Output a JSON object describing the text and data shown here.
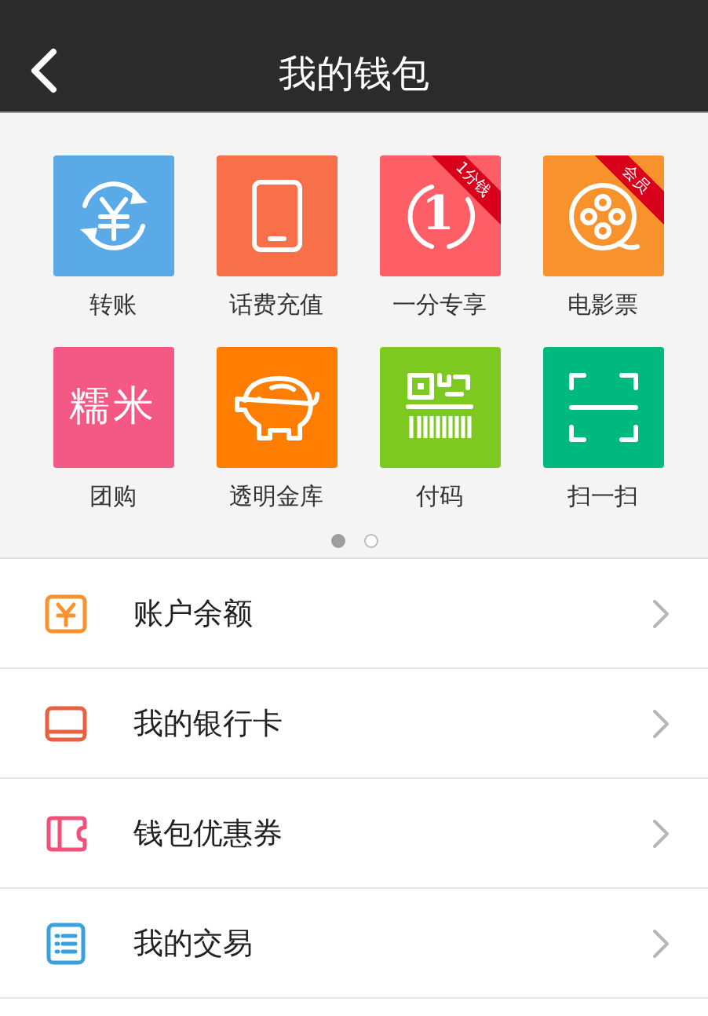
{
  "header": {
    "title": "我的钱包"
  },
  "grid": [
    {
      "label": "转账",
      "kind": "transfer",
      "color": "#5aaae7"
    },
    {
      "label": "话费充值",
      "kind": "phone",
      "color": "#f7704a"
    },
    {
      "label": "一分专享",
      "kind": "one",
      "color": "#fe5f67",
      "glyph": "1",
      "badge": "1分钱"
    },
    {
      "label": "电影票",
      "kind": "film",
      "color": "#f7922d",
      "badge": "会员"
    },
    {
      "label": "团购",
      "kind": "text",
      "color": "#f45985",
      "glyph": "糯米"
    },
    {
      "label": "透明金库",
      "kind": "piggy",
      "color": "#ff7d00"
    },
    {
      "label": "付码",
      "kind": "code",
      "color": "#7ec91f"
    },
    {
      "label": "扫一扫",
      "kind": "scan",
      "color": "#00b97f"
    }
  ],
  "pages": [
    {
      "selected": true
    },
    {
      "selected": false
    }
  ],
  "menu": [
    {
      "label": "账户余额",
      "kind": "balance",
      "color": "#f7922d"
    },
    {
      "label": "我的银行卡",
      "kind": "card",
      "color": "#e95f3f"
    },
    {
      "label": "钱包优惠券",
      "kind": "coupon",
      "color": "#f0507a"
    },
    {
      "label": "我的交易",
      "kind": "list",
      "color": "#3aa0dc"
    }
  ]
}
